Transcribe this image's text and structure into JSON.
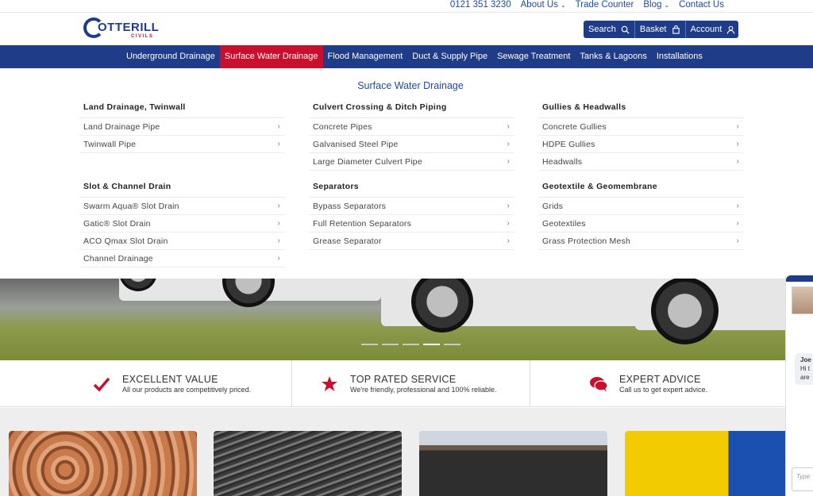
{
  "toplinks": {
    "phone": "0121 351 3230",
    "about": "About Us",
    "trade": "Trade Counter",
    "blog": "Blog",
    "contact": "Contact Us"
  },
  "logo": {
    "word": "OTTERILL",
    "sub": "CIVILS"
  },
  "actions": {
    "search": "Search",
    "basket": "Basket",
    "account": "Account"
  },
  "nav": [
    "Underground Drainage",
    "Surface Water Drainage",
    "Flood Management",
    "Duct & Supply Pipe",
    "Sewage Treatment",
    "Tanks & Lagoons",
    "Installations"
  ],
  "mega": {
    "title": "Surface Water Drainage",
    "columns": [
      {
        "heading": "Land Drainage, Twinwall",
        "items": [
          "Land Drainage Pipe",
          "Twinwall Pipe"
        ]
      },
      {
        "heading": "Culvert Crossing & Ditch Piping",
        "items": [
          "Concrete Pipes",
          "Galvanised Steel Pipe",
          "Large Diameter Culvert Pipe"
        ]
      },
      {
        "heading": "Gullies & Headwalls",
        "items": [
          "Concrete Gullies",
          "HDPE Gullies",
          "Headwalls"
        ]
      },
      {
        "heading": "Slot & Channel Drain",
        "items": [
          "Swarm Aqua® Slot Drain",
          "Gatic® Slot Drain",
          "ACO Qmax Slot Drain",
          "Channel Drainage"
        ]
      },
      {
        "heading": "Separators",
        "items": [
          "Bypass Separators",
          "Full Retention Separators",
          "Grease Separator"
        ]
      },
      {
        "heading": "Geotextile & Geomembrane",
        "items": [
          "Grids",
          "Geotextiles",
          "Grass Protection Mesh"
        ]
      }
    ]
  },
  "features": [
    {
      "title": "EXCELLENT VALUE",
      "text": "All our products are competitively priced.",
      "icon": "check-icon"
    },
    {
      "title": "TOP RATED SERVICE",
      "text": "We're friendly, professional and 100% reliable.",
      "icon": "star-icon"
    },
    {
      "title": "EXPERT ADVICE",
      "text": "Call us to get expert advice.",
      "icon": "chat-icon"
    }
  ],
  "chat": {
    "name": "Joe",
    "line1": "Hi t",
    "line2": "are",
    "placeholder": "Type"
  },
  "colors": {
    "brand": "#1f3c88",
    "accent": "#c8102e"
  }
}
